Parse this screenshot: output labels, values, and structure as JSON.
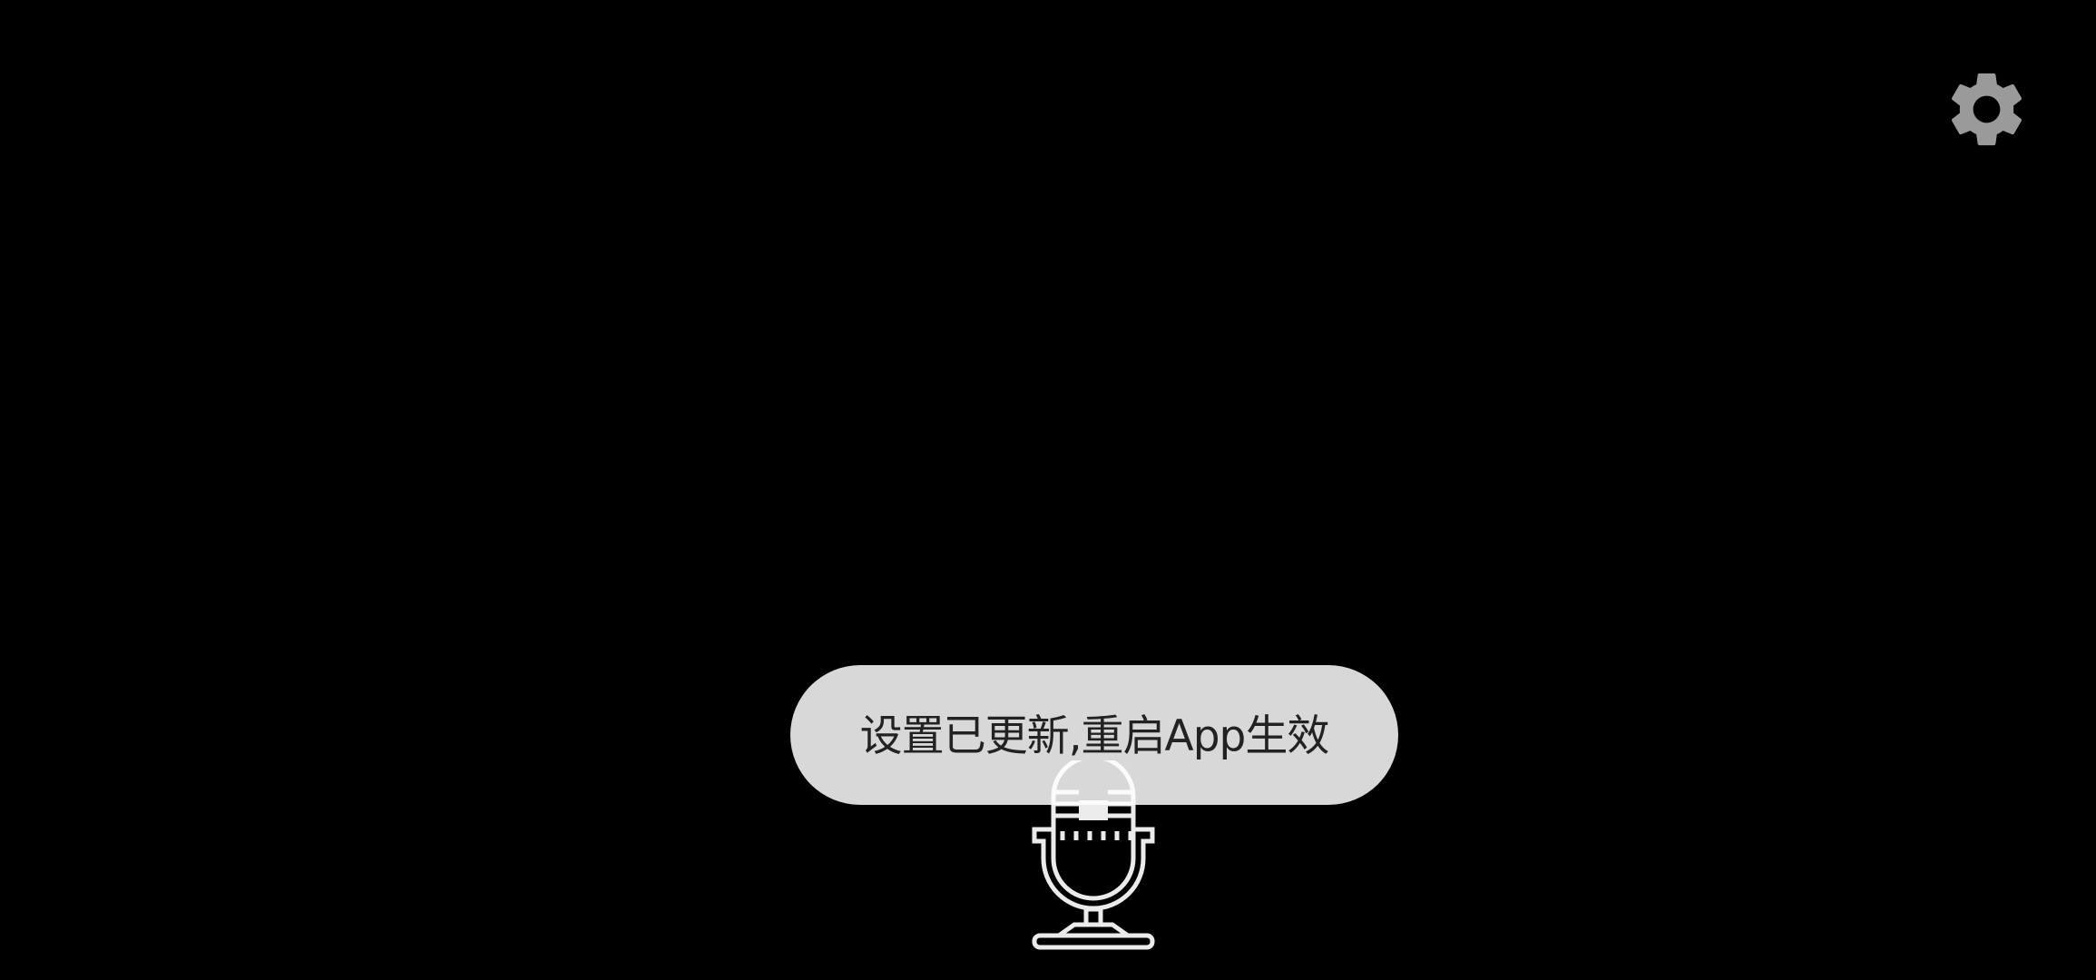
{
  "toolbar": {
    "settings_icon": "gear-icon",
    "settings_color": "#9a9a9a"
  },
  "toast": {
    "message": "设置已更新,重启App生效",
    "background": "#d8d8d8"
  },
  "main": {
    "record_icon": "microphone-icon"
  }
}
